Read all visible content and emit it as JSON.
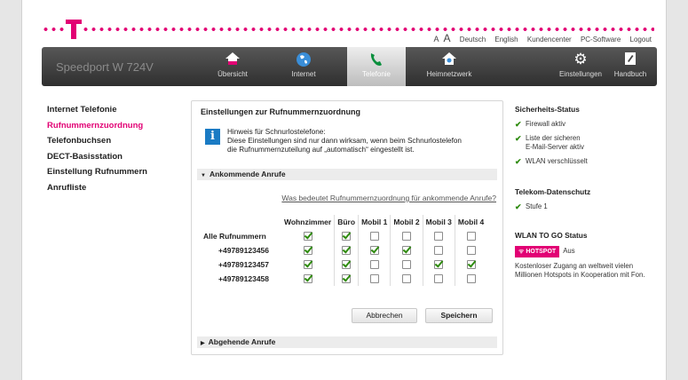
{
  "top_links": {
    "a_small": "A",
    "a_large": "A",
    "deutsch": "Deutsch",
    "english": "English",
    "kundencenter": "Kundencenter",
    "pc_software": "PC-Software",
    "logout": "Logout"
  },
  "brand": "Speedport W 724V",
  "nav": {
    "uebersicht": "Übersicht",
    "internet": "Internet",
    "telefonie": "Telefonie",
    "heimnetzwerk": "Heimnetzwerk",
    "einstellungen": "Einstellungen",
    "handbuch": "Handbuch",
    "active": "Telefonie"
  },
  "sidebar": {
    "items": [
      "Internet Telefonie",
      "Rufnummernzuordnung",
      "Telefonbuchsen",
      "DECT-Basisstation",
      "Einstellung Rufnummern",
      "Anrufliste"
    ],
    "active": "Rufnummernzuordnung"
  },
  "main": {
    "title": "Einstellungen zur Rufnummernzuordnung",
    "info_line1": "Hinweis für Schnurlostelefone:",
    "info_line2": "Diese Einstellungen sind nur dann wirksam, wenn beim Schnurlostelefon",
    "info_line3": "die Rufnummernzuteilung auf „automatisch“ eingestellt ist.",
    "incoming_label": "Ankommende Anrufe",
    "help_link": "Was bedeutet Rufnummernzuordnung für ankommende Anrufe?",
    "columns": [
      "Wohnzimmer",
      "Büro",
      "Mobil 1",
      "Mobil 2",
      "Mobil 3",
      "Mobil 4"
    ],
    "rows": [
      {
        "label": "Alle Rufnummern",
        "checks": [
          true,
          true,
          false,
          false,
          false,
          false
        ]
      },
      {
        "label": "+49789123456",
        "checks": [
          true,
          true,
          true,
          true,
          false,
          false
        ]
      },
      {
        "label": "+49789123457",
        "checks": [
          true,
          true,
          false,
          false,
          true,
          true
        ]
      },
      {
        "label": "+49789123458",
        "checks": [
          true,
          true,
          false,
          false,
          false,
          false
        ]
      }
    ],
    "cancel_label": "Abbrechen",
    "save_label": "Speichern",
    "outgoing_label": "Abgehende Anrufe"
  },
  "right": {
    "security_title": "Sicherheits-Status",
    "security_items": [
      "Firewall aktiv",
      "Liste der sicheren",
      "E-Mail-Server aktiv",
      "WLAN verschlüsselt"
    ],
    "privacy_title": "Telekom-Datenschutz",
    "privacy_item": "Stufe 1",
    "wlan_title": "WLAN TO GO Status",
    "hotspot_badge": "HOTSPOT",
    "hotspot_status": "Aus",
    "wlan_desc_line1": "Kostenloser Zugang an weltweit vielen",
    "wlan_desc_line2": "Millionen Hotspots in Kooperation mit Fon."
  },
  "colors": {
    "magenta": "#e20074",
    "check_green": "#2e8b0e",
    "info_blue": "#1a7bc4"
  }
}
